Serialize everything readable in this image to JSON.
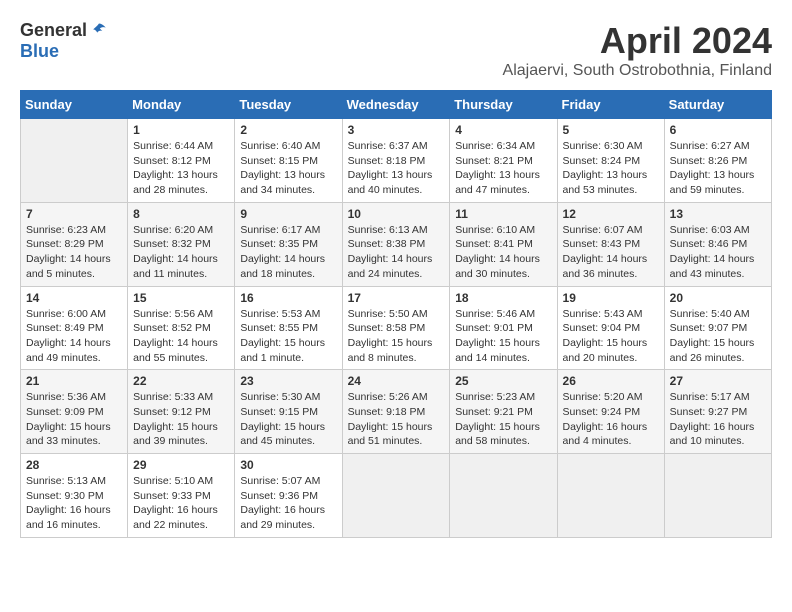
{
  "header": {
    "logo_general": "General",
    "logo_blue": "Blue",
    "title": "April 2024",
    "subtitle": "Alajaervi, South Ostrobothnia, Finland"
  },
  "calendar": {
    "days_of_week": [
      "Sunday",
      "Monday",
      "Tuesday",
      "Wednesday",
      "Thursday",
      "Friday",
      "Saturday"
    ],
    "weeks": [
      [
        {
          "day": "",
          "info": ""
        },
        {
          "day": "1",
          "info": "Sunrise: 6:44 AM\nSunset: 8:12 PM\nDaylight: 13 hours\nand 28 minutes."
        },
        {
          "day": "2",
          "info": "Sunrise: 6:40 AM\nSunset: 8:15 PM\nDaylight: 13 hours\nand 34 minutes."
        },
        {
          "day": "3",
          "info": "Sunrise: 6:37 AM\nSunset: 8:18 PM\nDaylight: 13 hours\nand 40 minutes."
        },
        {
          "day": "4",
          "info": "Sunrise: 6:34 AM\nSunset: 8:21 PM\nDaylight: 13 hours\nand 47 minutes."
        },
        {
          "day": "5",
          "info": "Sunrise: 6:30 AM\nSunset: 8:24 PM\nDaylight: 13 hours\nand 53 minutes."
        },
        {
          "day": "6",
          "info": "Sunrise: 6:27 AM\nSunset: 8:26 PM\nDaylight: 13 hours\nand 59 minutes."
        }
      ],
      [
        {
          "day": "7",
          "info": "Sunrise: 6:23 AM\nSunset: 8:29 PM\nDaylight: 14 hours\nand 5 minutes."
        },
        {
          "day": "8",
          "info": "Sunrise: 6:20 AM\nSunset: 8:32 PM\nDaylight: 14 hours\nand 11 minutes."
        },
        {
          "day": "9",
          "info": "Sunrise: 6:17 AM\nSunset: 8:35 PM\nDaylight: 14 hours\nand 18 minutes."
        },
        {
          "day": "10",
          "info": "Sunrise: 6:13 AM\nSunset: 8:38 PM\nDaylight: 14 hours\nand 24 minutes."
        },
        {
          "day": "11",
          "info": "Sunrise: 6:10 AM\nSunset: 8:41 PM\nDaylight: 14 hours\nand 30 minutes."
        },
        {
          "day": "12",
          "info": "Sunrise: 6:07 AM\nSunset: 8:43 PM\nDaylight: 14 hours\nand 36 minutes."
        },
        {
          "day": "13",
          "info": "Sunrise: 6:03 AM\nSunset: 8:46 PM\nDaylight: 14 hours\nand 43 minutes."
        }
      ],
      [
        {
          "day": "14",
          "info": "Sunrise: 6:00 AM\nSunset: 8:49 PM\nDaylight: 14 hours\nand 49 minutes."
        },
        {
          "day": "15",
          "info": "Sunrise: 5:56 AM\nSunset: 8:52 PM\nDaylight: 14 hours\nand 55 minutes."
        },
        {
          "day": "16",
          "info": "Sunrise: 5:53 AM\nSunset: 8:55 PM\nDaylight: 15 hours\nand 1 minute."
        },
        {
          "day": "17",
          "info": "Sunrise: 5:50 AM\nSunset: 8:58 PM\nDaylight: 15 hours\nand 8 minutes."
        },
        {
          "day": "18",
          "info": "Sunrise: 5:46 AM\nSunset: 9:01 PM\nDaylight: 15 hours\nand 14 minutes."
        },
        {
          "day": "19",
          "info": "Sunrise: 5:43 AM\nSunset: 9:04 PM\nDaylight: 15 hours\nand 20 minutes."
        },
        {
          "day": "20",
          "info": "Sunrise: 5:40 AM\nSunset: 9:07 PM\nDaylight: 15 hours\nand 26 minutes."
        }
      ],
      [
        {
          "day": "21",
          "info": "Sunrise: 5:36 AM\nSunset: 9:09 PM\nDaylight: 15 hours\nand 33 minutes."
        },
        {
          "day": "22",
          "info": "Sunrise: 5:33 AM\nSunset: 9:12 PM\nDaylight: 15 hours\nand 39 minutes."
        },
        {
          "day": "23",
          "info": "Sunrise: 5:30 AM\nSunset: 9:15 PM\nDaylight: 15 hours\nand 45 minutes."
        },
        {
          "day": "24",
          "info": "Sunrise: 5:26 AM\nSunset: 9:18 PM\nDaylight: 15 hours\nand 51 minutes."
        },
        {
          "day": "25",
          "info": "Sunrise: 5:23 AM\nSunset: 9:21 PM\nDaylight: 15 hours\nand 58 minutes."
        },
        {
          "day": "26",
          "info": "Sunrise: 5:20 AM\nSunset: 9:24 PM\nDaylight: 16 hours\nand 4 minutes."
        },
        {
          "day": "27",
          "info": "Sunrise: 5:17 AM\nSunset: 9:27 PM\nDaylight: 16 hours\nand 10 minutes."
        }
      ],
      [
        {
          "day": "28",
          "info": "Sunrise: 5:13 AM\nSunset: 9:30 PM\nDaylight: 16 hours\nand 16 minutes."
        },
        {
          "day": "29",
          "info": "Sunrise: 5:10 AM\nSunset: 9:33 PM\nDaylight: 16 hours\nand 22 minutes."
        },
        {
          "day": "30",
          "info": "Sunrise: 5:07 AM\nSunset: 9:36 PM\nDaylight: 16 hours\nand 29 minutes."
        },
        {
          "day": "",
          "info": ""
        },
        {
          "day": "",
          "info": ""
        },
        {
          "day": "",
          "info": ""
        },
        {
          "day": "",
          "info": ""
        }
      ]
    ]
  }
}
